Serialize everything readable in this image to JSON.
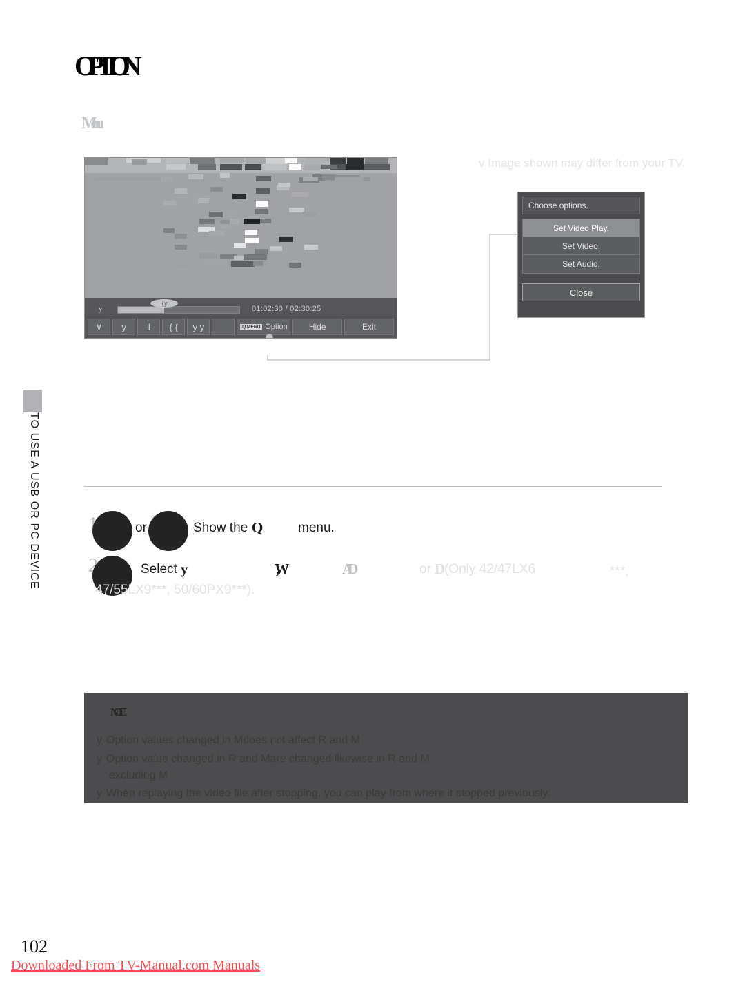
{
  "document": {
    "title": "OPTION",
    "sub_heading": "Menu",
    "page_number": "102",
    "footer_link": "Downloaded From TV-Manual.com Manuals",
    "sidebar_label": "TO USE A USB OR PC DEVICE"
  },
  "image_note": "v Image shown may differ from your TV.",
  "tv_screenshot": {
    "progress": {
      "left_marker": "y",
      "thumb_label": "{ y",
      "time": "01:02:30 / 02:30:25",
      "fill_percent": 38
    },
    "buttons": [
      {
        "name": "stop",
        "label": "∨"
      },
      {
        "name": "play",
        "label": "y"
      },
      {
        "name": "pause",
        "label": "‖"
      },
      {
        "name": "rewind",
        "label": "{ {"
      },
      {
        "name": "fast-forward",
        "label": "y y"
      },
      {
        "name": "blank",
        "label": ""
      }
    ],
    "option_button": {
      "badge": "Q.MENU",
      "label": "Option"
    },
    "hide_button": "Hide",
    "exit_button": "Exit"
  },
  "osd_dialog": {
    "title": "Choose options.",
    "items": [
      {
        "label": "Set Video Play.",
        "selected": true
      },
      {
        "label": "Set Video.",
        "selected": false
      },
      {
        "label": "Set Audio.",
        "selected": false
      }
    ],
    "close_label": "Close"
  },
  "steps": [
    {
      "number": "1",
      "or_label": "or",
      "text_main": "Show the",
      "text_glyph": "Q",
      "text_tail": "menu."
    },
    {
      "number": "2",
      "text_main": "Select",
      "glyph_1": "y",
      "glyph_2": ",W",
      "glyph_3": "AD",
      "text_or": "or",
      "glyph_4": "D",
      "text_models_1": "(Only 42/47LX6",
      "text_stars": "***,",
      "text_models_2": "47/55LX9***, 50/60PX9***)."
    }
  ],
  "note_box": {
    "label": "NOTE",
    "bullet": "y",
    "lines": [
      {
        "parts": [
          {
            "text": "Option values changed in",
            "style": "normal"
          },
          {
            "text": "Mdoes not affect",
            "style": "bold"
          },
          {
            "text": "R",
            "style": "bold"
          },
          {
            "text": "and",
            "style": "normal"
          },
          {
            "text": "M",
            "style": "bold"
          }
        ],
        "plain": "Option values changed in Mdoes not affect R                      and M"
      },
      {
        "plain": "Option value changed in R                and Mare changed likewise in                R                and M"
      },
      {
        "plain": "excluding M",
        "continuation": true
      },
      {
        "plain": "When replaying the video file after stopping, you can play from where it stopped previously."
      }
    ]
  },
  "colors": {
    "note_bg": "#4c4c4e",
    "osd_bg": "#4b4b4d",
    "osd_selected": "#8e8f92",
    "tv_controls": "#565658",
    "footer_red": "#ff4d4d"
  }
}
